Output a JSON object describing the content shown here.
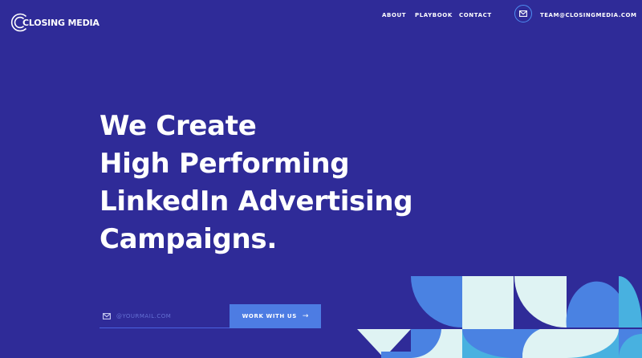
{
  "brand": {
    "name": "CLOSING MEDIA"
  },
  "nav": {
    "items": [
      "ABOUT",
      "PLAYBOOK",
      "CONTACT"
    ],
    "email": "TEAM@CLOSINGMEDIA.COM"
  },
  "hero": {
    "headline_lines": [
      "We Create",
      "High Performing",
      "LinkedIn Advertising",
      "Campaigns."
    ],
    "email_placeholder": "@YOURMAIL.COM",
    "cta_label": "WORK WITH US",
    "cta_arrow": "→"
  },
  "colors": {
    "background": "#2f2b98",
    "accent": "#4d7ce3",
    "shape_blue": "#4a82e2",
    "shape_light": "#dff3f3",
    "shape_cyan": "#48b1e0"
  },
  "icons": [
    "logo-ring-icon",
    "mail-icon",
    "arrow-right-icon"
  ]
}
